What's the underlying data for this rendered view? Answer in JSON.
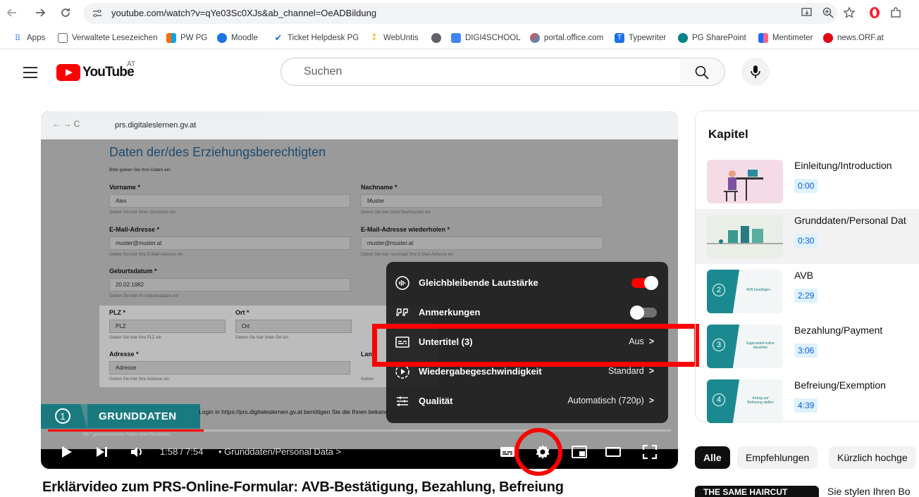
{
  "browser": {
    "url": "youtube.com/watch?v=qYe03Sc0XJs&ab_channel=OeADBildung",
    "bookmarks": [
      "Apps",
      "Verwaltete Lesezeichen",
      "PW PG",
      "Moodle",
      "Ticket Helpdesk PG",
      "WebUntis",
      "DIGI4SCHOOL",
      "portal.office.com",
      "Typewriter",
      "PG SharePoint",
      "Mentimeter",
      "news.ORF.at"
    ]
  },
  "header": {
    "logo": "YouTube",
    "country": "AT",
    "search_placeholder": "Suchen"
  },
  "video_content": {
    "inner_url": "prs.digitaleslernen.gv.at",
    "form_title": "Daten der/des Erziehungsberechtigten",
    "intro": "Bitte geben Sie Ihre Daten ein",
    "vorname_label": "Vorname *",
    "vorname_value": "Alex",
    "vorname_hint": "Geben Sie hier Ihren Vornamen ein",
    "nachname_label": "Nachname *",
    "nachname_value": "Muster",
    "nachname_hint": "Geben Sie hier Ihren Nachnamen ein",
    "email_label": "E-Mail-Adresse *",
    "email_value": "muster@muster.at",
    "email_hint": "Geben Sie hier Ihre E-Mail-Adresse ein",
    "email2_label": "E-Mail-Adresse wiederholen *",
    "email2_value": "muster@muster.at",
    "email2_hint": "Geben Sie hier nochmals Ihre E-Mail-Adresse ein",
    "geb_label": "Geburtsdatum *",
    "geb_value": "20.02.1982",
    "geb_hint": "Geben Sie hier Ihr Geburtsdatum ein",
    "plz_label": "PLZ *",
    "plz_value": "PLZ",
    "plz_hint": "Geben Sie hier Ihre PLZ ein",
    "ort_label": "Ort *",
    "ort_value": "Ort",
    "ort_hint": "Geben Sie hier Ihren Ort ein",
    "adresse_label": "Adresse *",
    "adresse_value": "Adresse",
    "adresse_hint": "Geben Sie hier Ihre Adresse ein",
    "land_label": "Lan",
    "land_hint": "Geben",
    "chapter_number": "1",
    "chapter_badge": "GRUNDDATEN",
    "login_line": "Login in https://prs.digitaleslernen.gv.at benötigen Sie die Ihnen bekann",
    "footnote": "Mit * gekennzeichnete Felder sind Pflichtfelder."
  },
  "player": {
    "progress_fraction": 0.25,
    "time": "1:58 / 7:54",
    "chapter": "• Grunddaten/Personal Data",
    "chapter_chevron": ">"
  },
  "settings_menu": {
    "items": [
      {
        "label": "Gleichbleibende Lautstärke",
        "value": "",
        "toggle": true
      },
      {
        "label": "Anmerkungen",
        "value": "",
        "toggle": false
      },
      {
        "label": "Untertitel (3)",
        "value": "Aus"
      },
      {
        "label": "Wiedergabegeschwindigkeit",
        "value": "Standard"
      },
      {
        "label": "Qualität",
        "value": "Automatisch (720p)"
      }
    ],
    "chevron": ">"
  },
  "chapters_panel": {
    "title": "Kapitel",
    "items": [
      {
        "title": "Einleitung/Introduction",
        "time": "0:00",
        "num": ""
      },
      {
        "title": "Grunddaten/Personal Dat",
        "time": "0:30",
        "num": ""
      },
      {
        "title": "AVB",
        "time": "2:29",
        "num": "2",
        "thumb_text": "AVB bestätigen"
      },
      {
        "title": "Bezahlung/Payment",
        "time": "3:06",
        "num": "3",
        "thumb_text": "Eigenanteil online bezahlen"
      },
      {
        "title": "Befreiung/Exemption",
        "time": "4:39",
        "num": "4",
        "thumb_text": "Antrag auf Befreiung stellen"
      }
    ]
  },
  "chips": [
    "Alle",
    "Empfehlungen",
    "Kürzlich hochge"
  ],
  "video_title": "Erklärvideo zum PRS-Online-Formular: AVB-Bestätigung, Bezahlung, Befreiung",
  "recommendation": {
    "thumb_text": "THE SAME HAIRCUT",
    "title": "Sie stylen Ihren Bo"
  },
  "colors": {
    "youtube_red": "#ff0000",
    "teal": "#1b7a80",
    "link_blue": "#065fd4"
  }
}
